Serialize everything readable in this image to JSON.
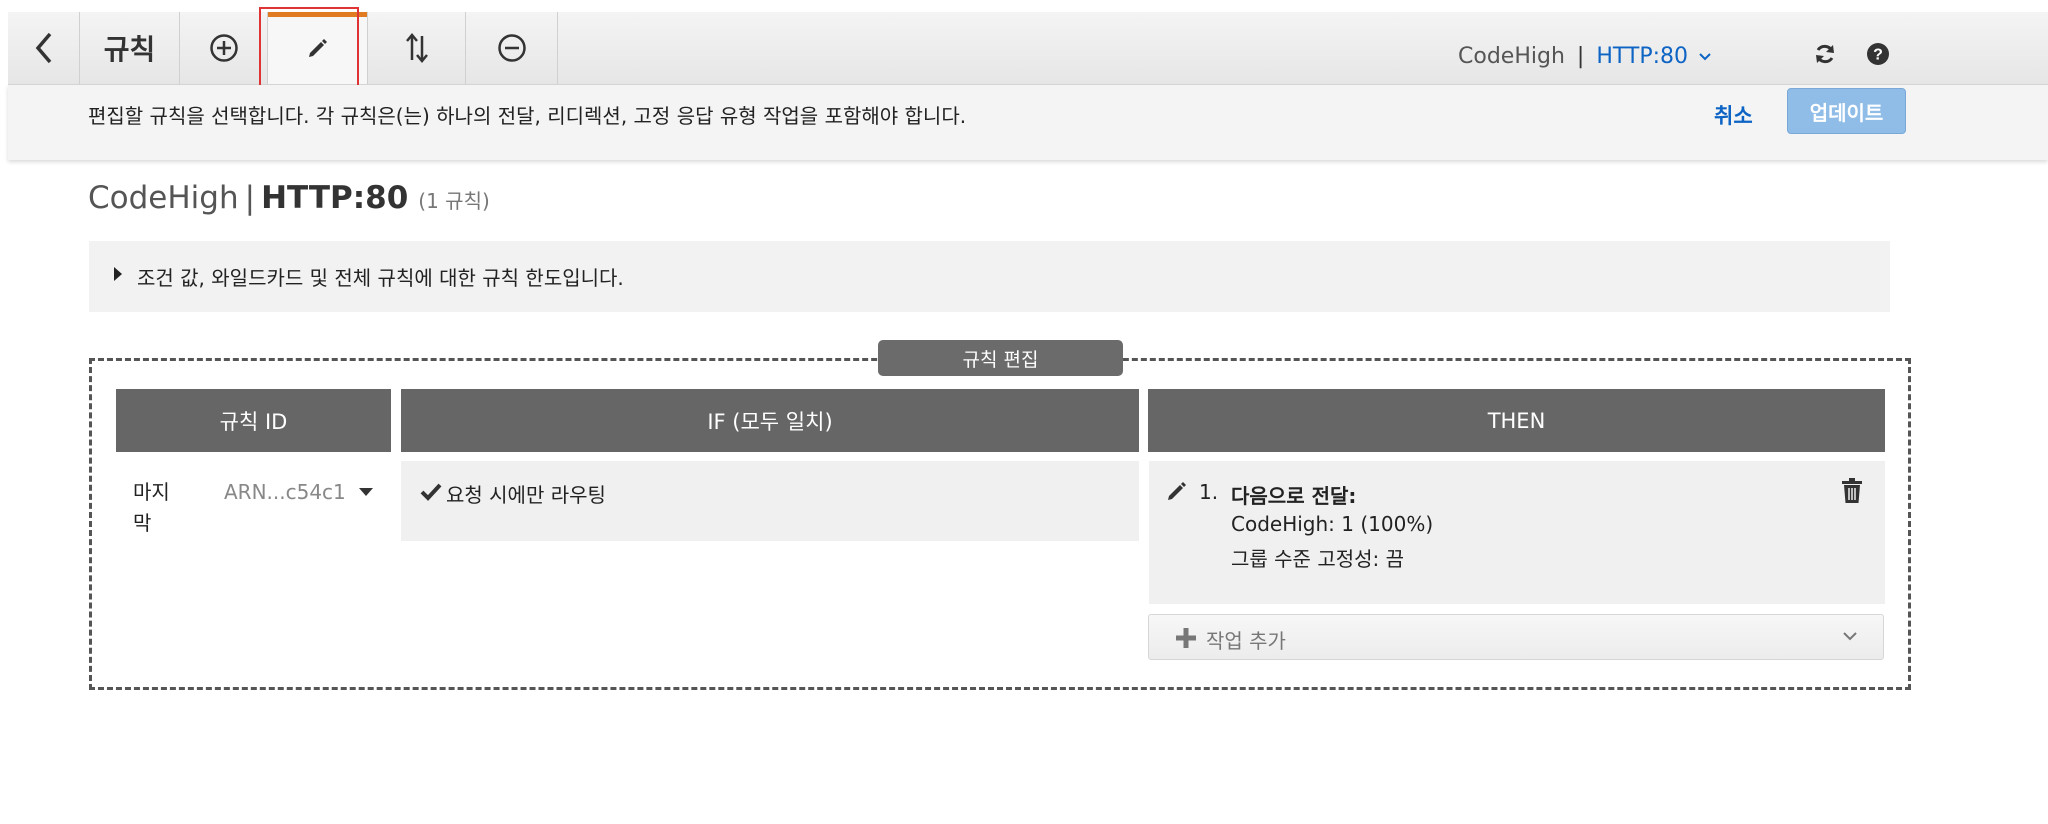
{
  "toolbar": {
    "title": "규칙",
    "breadcrumb_service": "CodeHigh",
    "breadcrumb_sep": "|",
    "breadcrumb_listener": "HTTP:80",
    "icons": [
      "back-chevron-icon",
      "add-circle-icon",
      "pencil-icon",
      "sort-arrows-icon",
      "remove-circle-icon",
      "refresh-icon",
      "help-icon"
    ]
  },
  "subbar": {
    "message": "편집할 규칙을 선택합니다. 각 규칙은(는) 하나의 전달, 리디렉션, 고정 응답 유형 작업을 포함해야 합니다.",
    "cancel_label": "취소",
    "update_label": "업데이트"
  },
  "page": {
    "service": "CodeHigh",
    "sep": "|",
    "listener": "HTTP:80",
    "rule_count": "(1 규칙)"
  },
  "info": {
    "text": "조건 값, 와일드카드 및 전체 규칙에 대한 규칙 한도입니다."
  },
  "editor": {
    "label": "규칙 편집",
    "columns": [
      "규칙 ID",
      "IF (모두 일치)",
      "THEN"
    ],
    "rule": {
      "priority": "마지막",
      "arn": "ARN...c54c1",
      "condition": "요청 시에만 라우팅",
      "action_number": "1.",
      "action_title": "다음으로 전달:",
      "action_target": "CodeHigh: 1 (100%)",
      "action_stickiness": "그룹 수준 고정성: 끔"
    },
    "add_action_label": "작업 추가"
  },
  "colors": {
    "accent_orange": "#e07b22",
    "link_blue": "#0d64c4",
    "update_button": "#8fbde8",
    "header_gray": "#666666",
    "highlight_red": "#e03434"
  }
}
